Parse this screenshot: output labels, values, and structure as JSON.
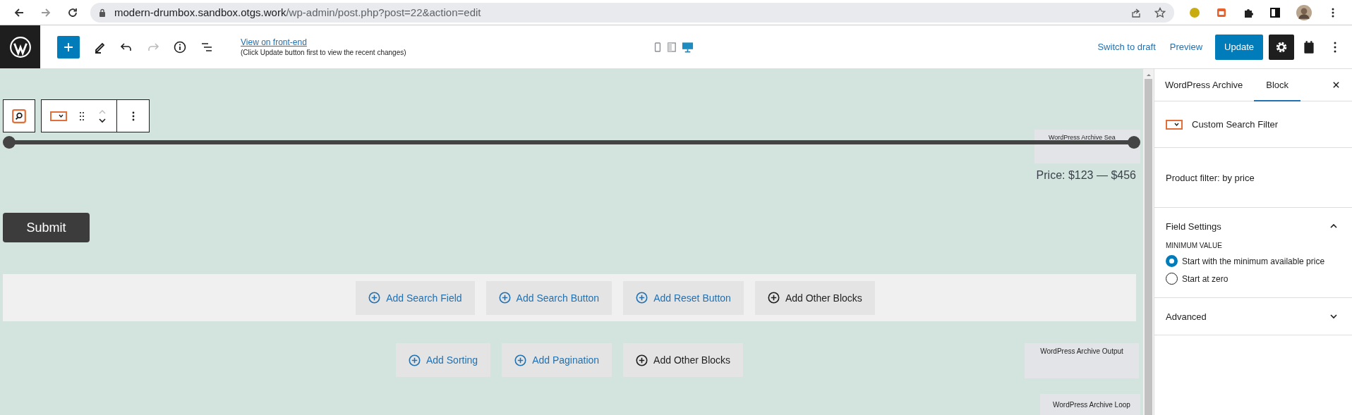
{
  "browser": {
    "url_host": "modern-drumbox.sandbox.otgs.work",
    "url_path": "/wp-admin/post.php?post=22&action=edit"
  },
  "toolbar": {
    "view_link": "View on front-end",
    "view_note": "(Click Update button first to view the recent changes)",
    "devices": [
      {
        "kind": "mobile",
        "selected": false
      },
      {
        "kind": "tablet",
        "selected": false
      },
      {
        "kind": "desktop",
        "selected": true
      }
    ],
    "switch_to_draft": "Switch to draft",
    "preview": "Preview",
    "update": "Update",
    "settings_selected": true
  },
  "canvas": {
    "slider_thumbs": [
      {
        "level": 0
      },
      {
        "level": 1
      }
    ],
    "search_block_label": "WordPress Archive Sea",
    "price": "Price: $123 — $456",
    "submit": "Submit",
    "search_buttons": [
      {
        "label": "Add Search Field",
        "kind": "add"
      },
      {
        "label": "Add Search Button",
        "kind": "add"
      },
      {
        "label": "Add Reset Button",
        "kind": "add"
      },
      {
        "label": "Add Other Blocks",
        "kind": "other"
      }
    ],
    "output_buttons": [
      {
        "label": "Add Sorting",
        "kind": "add"
      },
      {
        "label": "Add Pagination",
        "kind": "add"
      },
      {
        "label": "Add Other Blocks",
        "kind": "other"
      }
    ],
    "output_label": "WordPress Archive Output",
    "loop_label": "WordPress Archive Loop"
  },
  "sidebar": {
    "tabs": [
      {
        "label": "WordPress Archive",
        "selected": false
      },
      {
        "label": "Block",
        "selected": true
      }
    ],
    "block_name": "Custom Search Filter",
    "description": "Product filter: by price",
    "field_settings": {
      "title": "Field Settings",
      "expanded": true,
      "group_label": "MINIMUM VALUE",
      "options": [
        {
          "label": "Start with the minimum available price",
          "selected": true
        },
        {
          "label": "Start at zero",
          "selected": false
        }
      ]
    },
    "advanced": {
      "title": "Advanced",
      "expanded": false
    }
  }
}
